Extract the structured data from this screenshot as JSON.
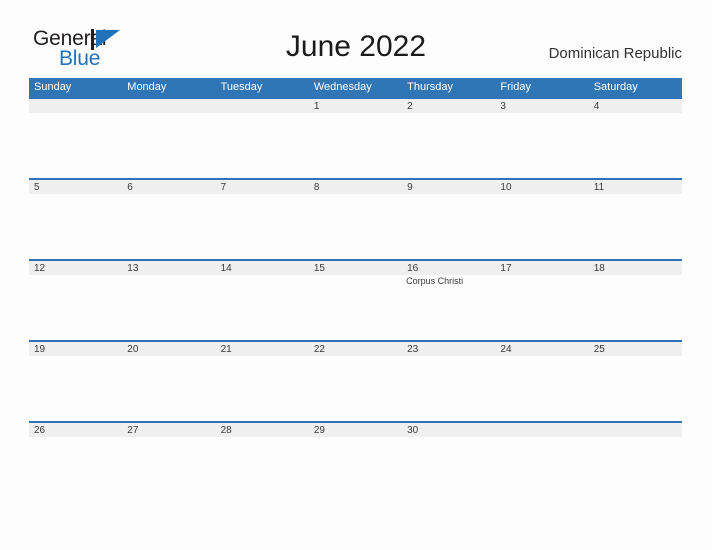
{
  "brand": {
    "name_part1": "General",
    "name_part2": "Blue",
    "mark": "triangle-logo-icon",
    "color_dark": "#231f20",
    "color_blue": "#2272b9"
  },
  "header": {
    "title": "June 2022",
    "country": "Dominican Republic"
  },
  "theme": {
    "header_blue": "#3075b5",
    "band_gray": "#efefef",
    "band_border": "#2f72b5",
    "page_background": "#fdfdfd",
    "text_dark": "#3b3b3b"
  },
  "calendar": {
    "month": "June",
    "year": "2022",
    "weekdays": [
      "Sunday",
      "Monday",
      "Tuesday",
      "Wednesday",
      "Thursday",
      "Friday",
      "Saturday"
    ],
    "weeks": [
      [
        {
          "day": "",
          "event": ""
        },
        {
          "day": "",
          "event": ""
        },
        {
          "day": "",
          "event": ""
        },
        {
          "day": "1",
          "event": ""
        },
        {
          "day": "2",
          "event": ""
        },
        {
          "day": "3",
          "event": ""
        },
        {
          "day": "4",
          "event": ""
        }
      ],
      [
        {
          "day": "5",
          "event": ""
        },
        {
          "day": "6",
          "event": ""
        },
        {
          "day": "7",
          "event": ""
        },
        {
          "day": "8",
          "event": ""
        },
        {
          "day": "9",
          "event": ""
        },
        {
          "day": "10",
          "event": ""
        },
        {
          "day": "11",
          "event": ""
        }
      ],
      [
        {
          "day": "12",
          "event": ""
        },
        {
          "day": "13",
          "event": ""
        },
        {
          "day": "14",
          "event": ""
        },
        {
          "day": "15",
          "event": ""
        },
        {
          "day": "16",
          "event": "Corpus Christi"
        },
        {
          "day": "17",
          "event": ""
        },
        {
          "day": "18",
          "event": ""
        }
      ],
      [
        {
          "day": "19",
          "event": ""
        },
        {
          "day": "20",
          "event": ""
        },
        {
          "day": "21",
          "event": ""
        },
        {
          "day": "22",
          "event": ""
        },
        {
          "day": "23",
          "event": ""
        },
        {
          "day": "24",
          "event": ""
        },
        {
          "day": "25",
          "event": ""
        }
      ],
      [
        {
          "day": "26",
          "event": ""
        },
        {
          "day": "27",
          "event": ""
        },
        {
          "day": "28",
          "event": ""
        },
        {
          "day": "29",
          "event": ""
        },
        {
          "day": "30",
          "event": ""
        },
        {
          "day": "",
          "event": ""
        },
        {
          "day": "",
          "event": ""
        }
      ]
    ]
  }
}
